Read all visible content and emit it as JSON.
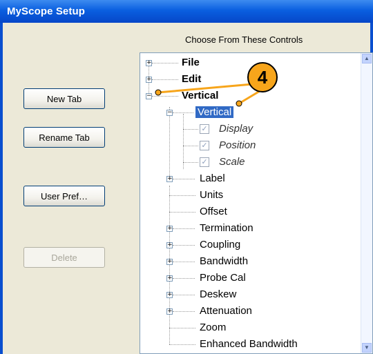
{
  "window": {
    "title": "MyScope Setup"
  },
  "header": {
    "choose_label": "Choose From These Controls"
  },
  "buttons": {
    "new_tab": "New Tab",
    "rename_tab": "Rename Tab",
    "user_pref": "User Pref…",
    "delete": "Delete"
  },
  "tree": {
    "file": "File",
    "edit": "Edit",
    "vertical": "Vertical",
    "vertical_child": "Vertical",
    "display": "Display",
    "position": "Position",
    "scale": "Scale",
    "label": "Label",
    "units": "Units",
    "offset": "Offset",
    "termination": "Termination",
    "coupling": "Coupling",
    "bandwidth": "Bandwidth",
    "probe_cal": "Probe Cal",
    "deskew": "Deskew",
    "attenuation": "Attenuation",
    "zoom": "Zoom",
    "enhanced_bandwidth": "Enhanced Bandwidth"
  },
  "callout": {
    "number": "4"
  },
  "colors": {
    "title_bar": "#0a5fe0",
    "selection": "#316ac5",
    "callout": "#f7a51b"
  }
}
